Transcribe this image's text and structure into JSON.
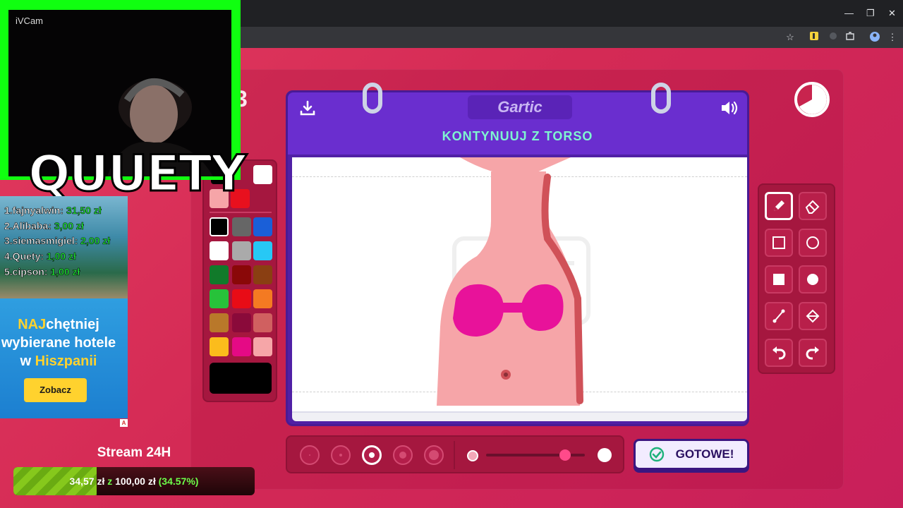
{
  "browser": {
    "window_controls": [
      "—",
      "❐",
      "✕"
    ]
  },
  "game": {
    "logo": "Gartic",
    "prompt": "KONTYNUUJ Z TORSO",
    "round_partial": "3",
    "done_label": "GOTOWE!",
    "pen_size_selected_index": 2,
    "opacity_level": 0.8
  },
  "palette": {
    "colors": [
      "#000000",
      "#ffffff",
      "#f6a5a8",
      "#e8101e",
      "#000000",
      "#666666",
      "#1a5fd8",
      "#ffffff",
      "#aaaaaa",
      "#27c8f5",
      "#117a2a",
      "#8a0808",
      "#8a3f12",
      "#27c23a",
      "#e80c16",
      "#f47a22",
      "#b9782a",
      "#8a0a3a",
      "#d06060",
      "#fbbc1c",
      "#e50a85",
      "#f6a6a8"
    ],
    "selected": "#000000"
  },
  "overlay": {
    "cam_label": "iVCam",
    "streamer_name": "QUUETY",
    "donors": [
      {
        "name": "1.fajnyalwin:",
        "amount": "31,50 zł"
      },
      {
        "name": "2.Alibaba:",
        "amount": "3,00 zł"
      },
      {
        "name": "3.siemasmigiel:",
        "amount": "2,00 zł"
      },
      {
        "name": "4.Quety:",
        "amount": "1,00 zł"
      },
      {
        "name": "5.cipson:",
        "amount": "1,00 zł"
      }
    ],
    "ad": {
      "line1_highlight": "NAJ",
      "line1_rest": "chętniej",
      "line2": "wybierane hotele",
      "line3_pre": "w ",
      "line3_highlight": "Hiszpanii",
      "button": "Zobacz",
      "badge": "A"
    },
    "goal": {
      "title": "Stream 24H",
      "current": "34,57 zł",
      "separator": "z",
      "target": "100,00 zł",
      "percent_text": "(34.57%)",
      "progress": 0.3457
    }
  }
}
